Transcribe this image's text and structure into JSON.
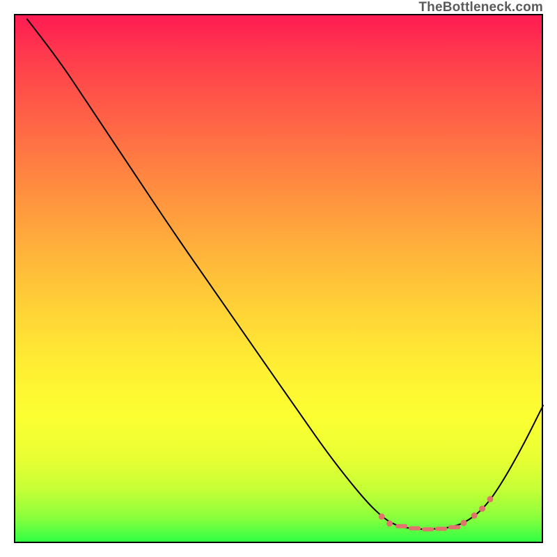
{
  "watermark": "TheBottleneck.com",
  "chart_data": {
    "type": "line",
    "title": "",
    "xlabel": "",
    "ylabel": "",
    "xlim": [
      0,
      100
    ],
    "ylim": [
      0,
      100
    ],
    "grid": false,
    "legend": false,
    "curve_points": [
      {
        "x": 2.5,
        "y": 99
      },
      {
        "x": 8,
        "y": 92
      },
      {
        "x": 14,
        "y": 83
      },
      {
        "x": 22,
        "y": 71
      },
      {
        "x": 30,
        "y": 59
      },
      {
        "x": 38,
        "y": 47.5
      },
      {
        "x": 46,
        "y": 36
      },
      {
        "x": 54,
        "y": 24.5
      },
      {
        "x": 60,
        "y": 16
      },
      {
        "x": 66,
        "y": 8.5
      },
      {
        "x": 69.5,
        "y": 5
      },
      {
        "x": 72,
        "y": 3.4
      },
      {
        "x": 75,
        "y": 2.7
      },
      {
        "x": 79,
        "y": 2.6
      },
      {
        "x": 83,
        "y": 3.0
      },
      {
        "x": 86,
        "y": 4.3
      },
      {
        "x": 89,
        "y": 6.8
      },
      {
        "x": 92,
        "y": 11
      },
      {
        "x": 96,
        "y": 18
      },
      {
        "x": 100,
        "y": 26
      }
    ],
    "highlight_dots": [
      {
        "x": 69.5,
        "y": 5.0
      },
      {
        "x": 71.0,
        "y": 3.7
      },
      {
        "x": 85.0,
        "y": 3.8
      },
      {
        "x": 87.0,
        "y": 5.2
      },
      {
        "x": 88.5,
        "y": 6.5
      },
      {
        "x": 90.0,
        "y": 8.3
      }
    ],
    "highlight_dashes": [
      {
        "x1": 72.5,
        "y": 3.2,
        "x2": 74.0
      },
      {
        "x1": 75.0,
        "y": 2.8,
        "x2": 76.5
      },
      {
        "x1": 77.5,
        "y": 2.6,
        "x2": 79.0
      },
      {
        "x1": 80.0,
        "y": 2.7,
        "x2": 81.5
      },
      {
        "x1": 82.5,
        "y": 3.0,
        "x2": 84.0
      }
    ],
    "colors": {
      "curve": "#000000",
      "highlight": "#e0746c"
    }
  }
}
